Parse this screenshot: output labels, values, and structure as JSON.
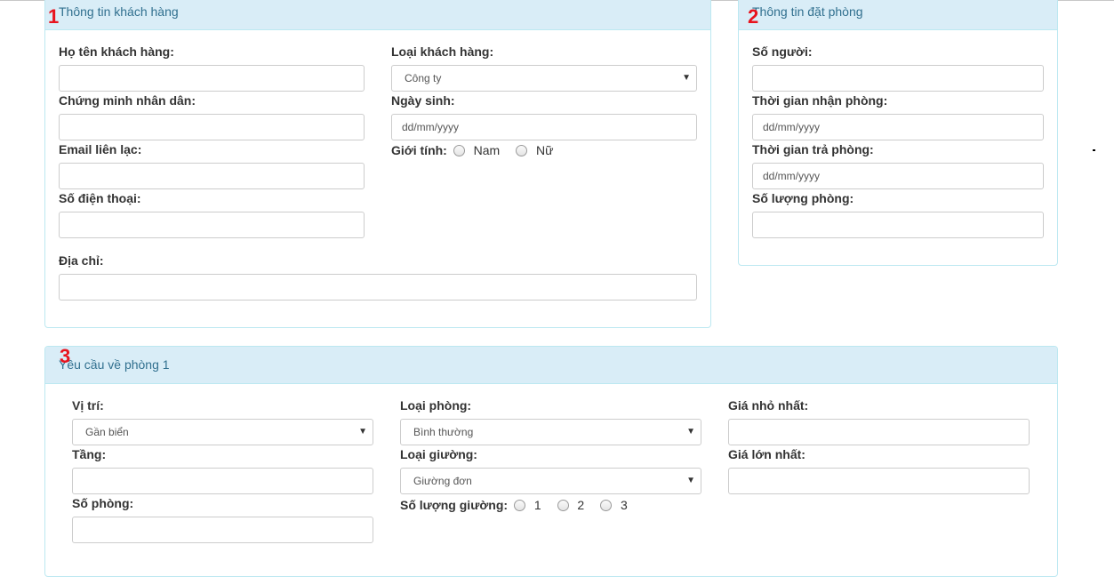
{
  "customer_panel": {
    "number": "1",
    "title": "Thông tin khách hàng",
    "full_name_label": "Họ tên khách hàng:",
    "customer_type_label": "Loại khách hàng:",
    "customer_type_value": "Công ty",
    "id_card_label": "Chứng minh nhân dân:",
    "birthday_label": "Ngày sinh:",
    "birthday_placeholder": "dd/mm/yyyy",
    "email_label": "Email liên lạc:",
    "gender_label": "Giới tính:",
    "gender_options": [
      "Nam",
      "Nữ"
    ],
    "phone_label": "Số điện thoại:",
    "address_label": "Địa chỉ:"
  },
  "booking_panel": {
    "number": "2",
    "title": "Thông tin đặt phòng",
    "guests_label": "Số người:",
    "checkin_label": "Thời gian nhận phòng:",
    "checkin_placeholder": "dd/mm/yyyy",
    "checkout_label": "Thời gian trả phòng:",
    "checkout_placeholder": "dd/mm/yyyy",
    "room_count_label": "Số lượng phòng:"
  },
  "room_panel": {
    "number": "3",
    "title": "Yêu cầu về phòng 1",
    "location_label": "Vị trí:",
    "location_value": "Gần biển",
    "room_type_label": "Loại phòng:",
    "room_type_value": "Bình thường",
    "min_price_label": "Giá nhỏ nhất:",
    "floor_label": "Tầng:",
    "bed_type_label": "Loại giường:",
    "bed_type_value": "Giường đơn",
    "max_price_label": "Giá lớn nhất:",
    "room_number_label": "Số phòng:",
    "bed_count_label": "Số lượng giường:",
    "bed_count_options": [
      "1",
      "2",
      "3"
    ]
  }
}
